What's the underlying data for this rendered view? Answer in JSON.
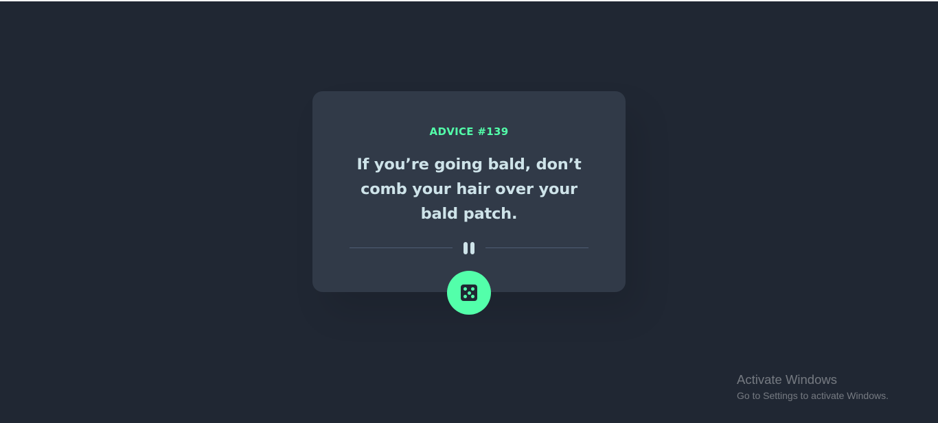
{
  "colors": {
    "background": "#202733",
    "card": "#313a48",
    "accent": "#53ffaa",
    "text": "#cee3e9",
    "divider": "#4f5d74"
  },
  "advice": {
    "id_label": "ADVICE #139",
    "text": "If you’re going bald, don’t comb your hair over your bald patch."
  },
  "icons": {
    "divider": "pause-icon",
    "button": "dice-icon"
  },
  "watermark": {
    "title": "Activate Windows",
    "subtitle": "Go to Settings to activate Windows."
  }
}
